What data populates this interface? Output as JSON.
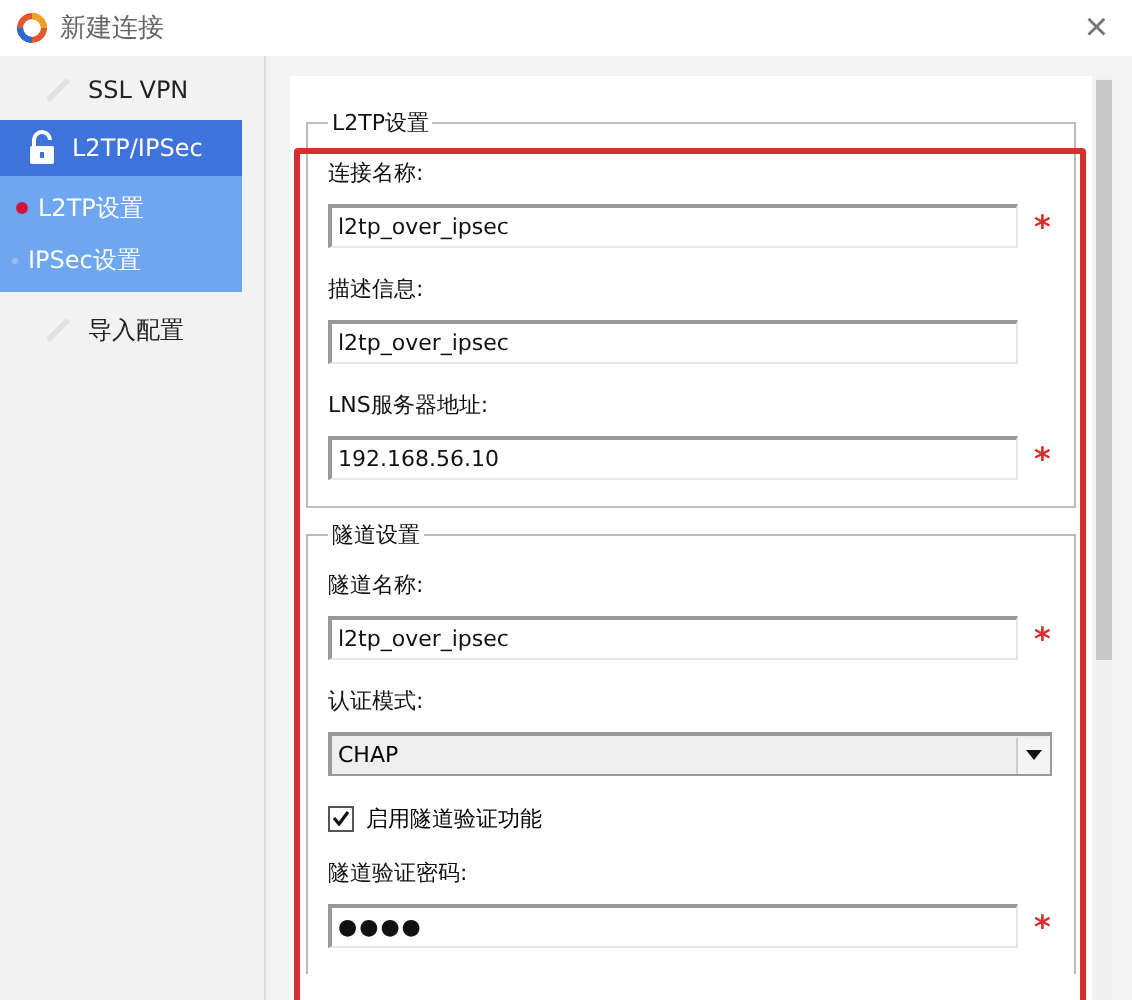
{
  "window": {
    "title": "新建连接",
    "close": "×"
  },
  "sidebar": {
    "items": [
      {
        "label": "SSL VPN",
        "selected": false
      },
      {
        "label": "L2TP/IPSec",
        "selected": true,
        "children": [
          {
            "label": "L2TP设置",
            "selected": true
          },
          {
            "label": "IPSec设置",
            "selected": false
          }
        ]
      },
      {
        "label": "导入配置",
        "selected": false
      }
    ]
  },
  "sections": [
    {
      "title": "L2TP设置",
      "fields": [
        {
          "kind": "text",
          "label": "连接名称:",
          "value": "l2tp_over_ipsec",
          "mark": "*"
        },
        {
          "kind": "text",
          "label": "描述信息:",
          "value": "l2tp_over_ipsec"
        },
        {
          "kind": "text",
          "label": "LNS服务器地址:",
          "value": "192.168.56.10",
          "mark": "*"
        }
      ]
    },
    {
      "title": "隧道设置",
      "fields": [
        {
          "kind": "text",
          "label": "隧道名称:",
          "value": "l2tp_over_ipsec",
          "mark": "*"
        },
        {
          "kind": "select",
          "label": "认证模式:",
          "value": "CHAP"
        },
        {
          "kind": "checkbox",
          "label": "启用隧道验证功能",
          "checked": true
        },
        {
          "kind": "password",
          "label": "隧道验证密码:",
          "value": "●●●●",
          "mark": "*"
        }
      ]
    }
  ]
}
